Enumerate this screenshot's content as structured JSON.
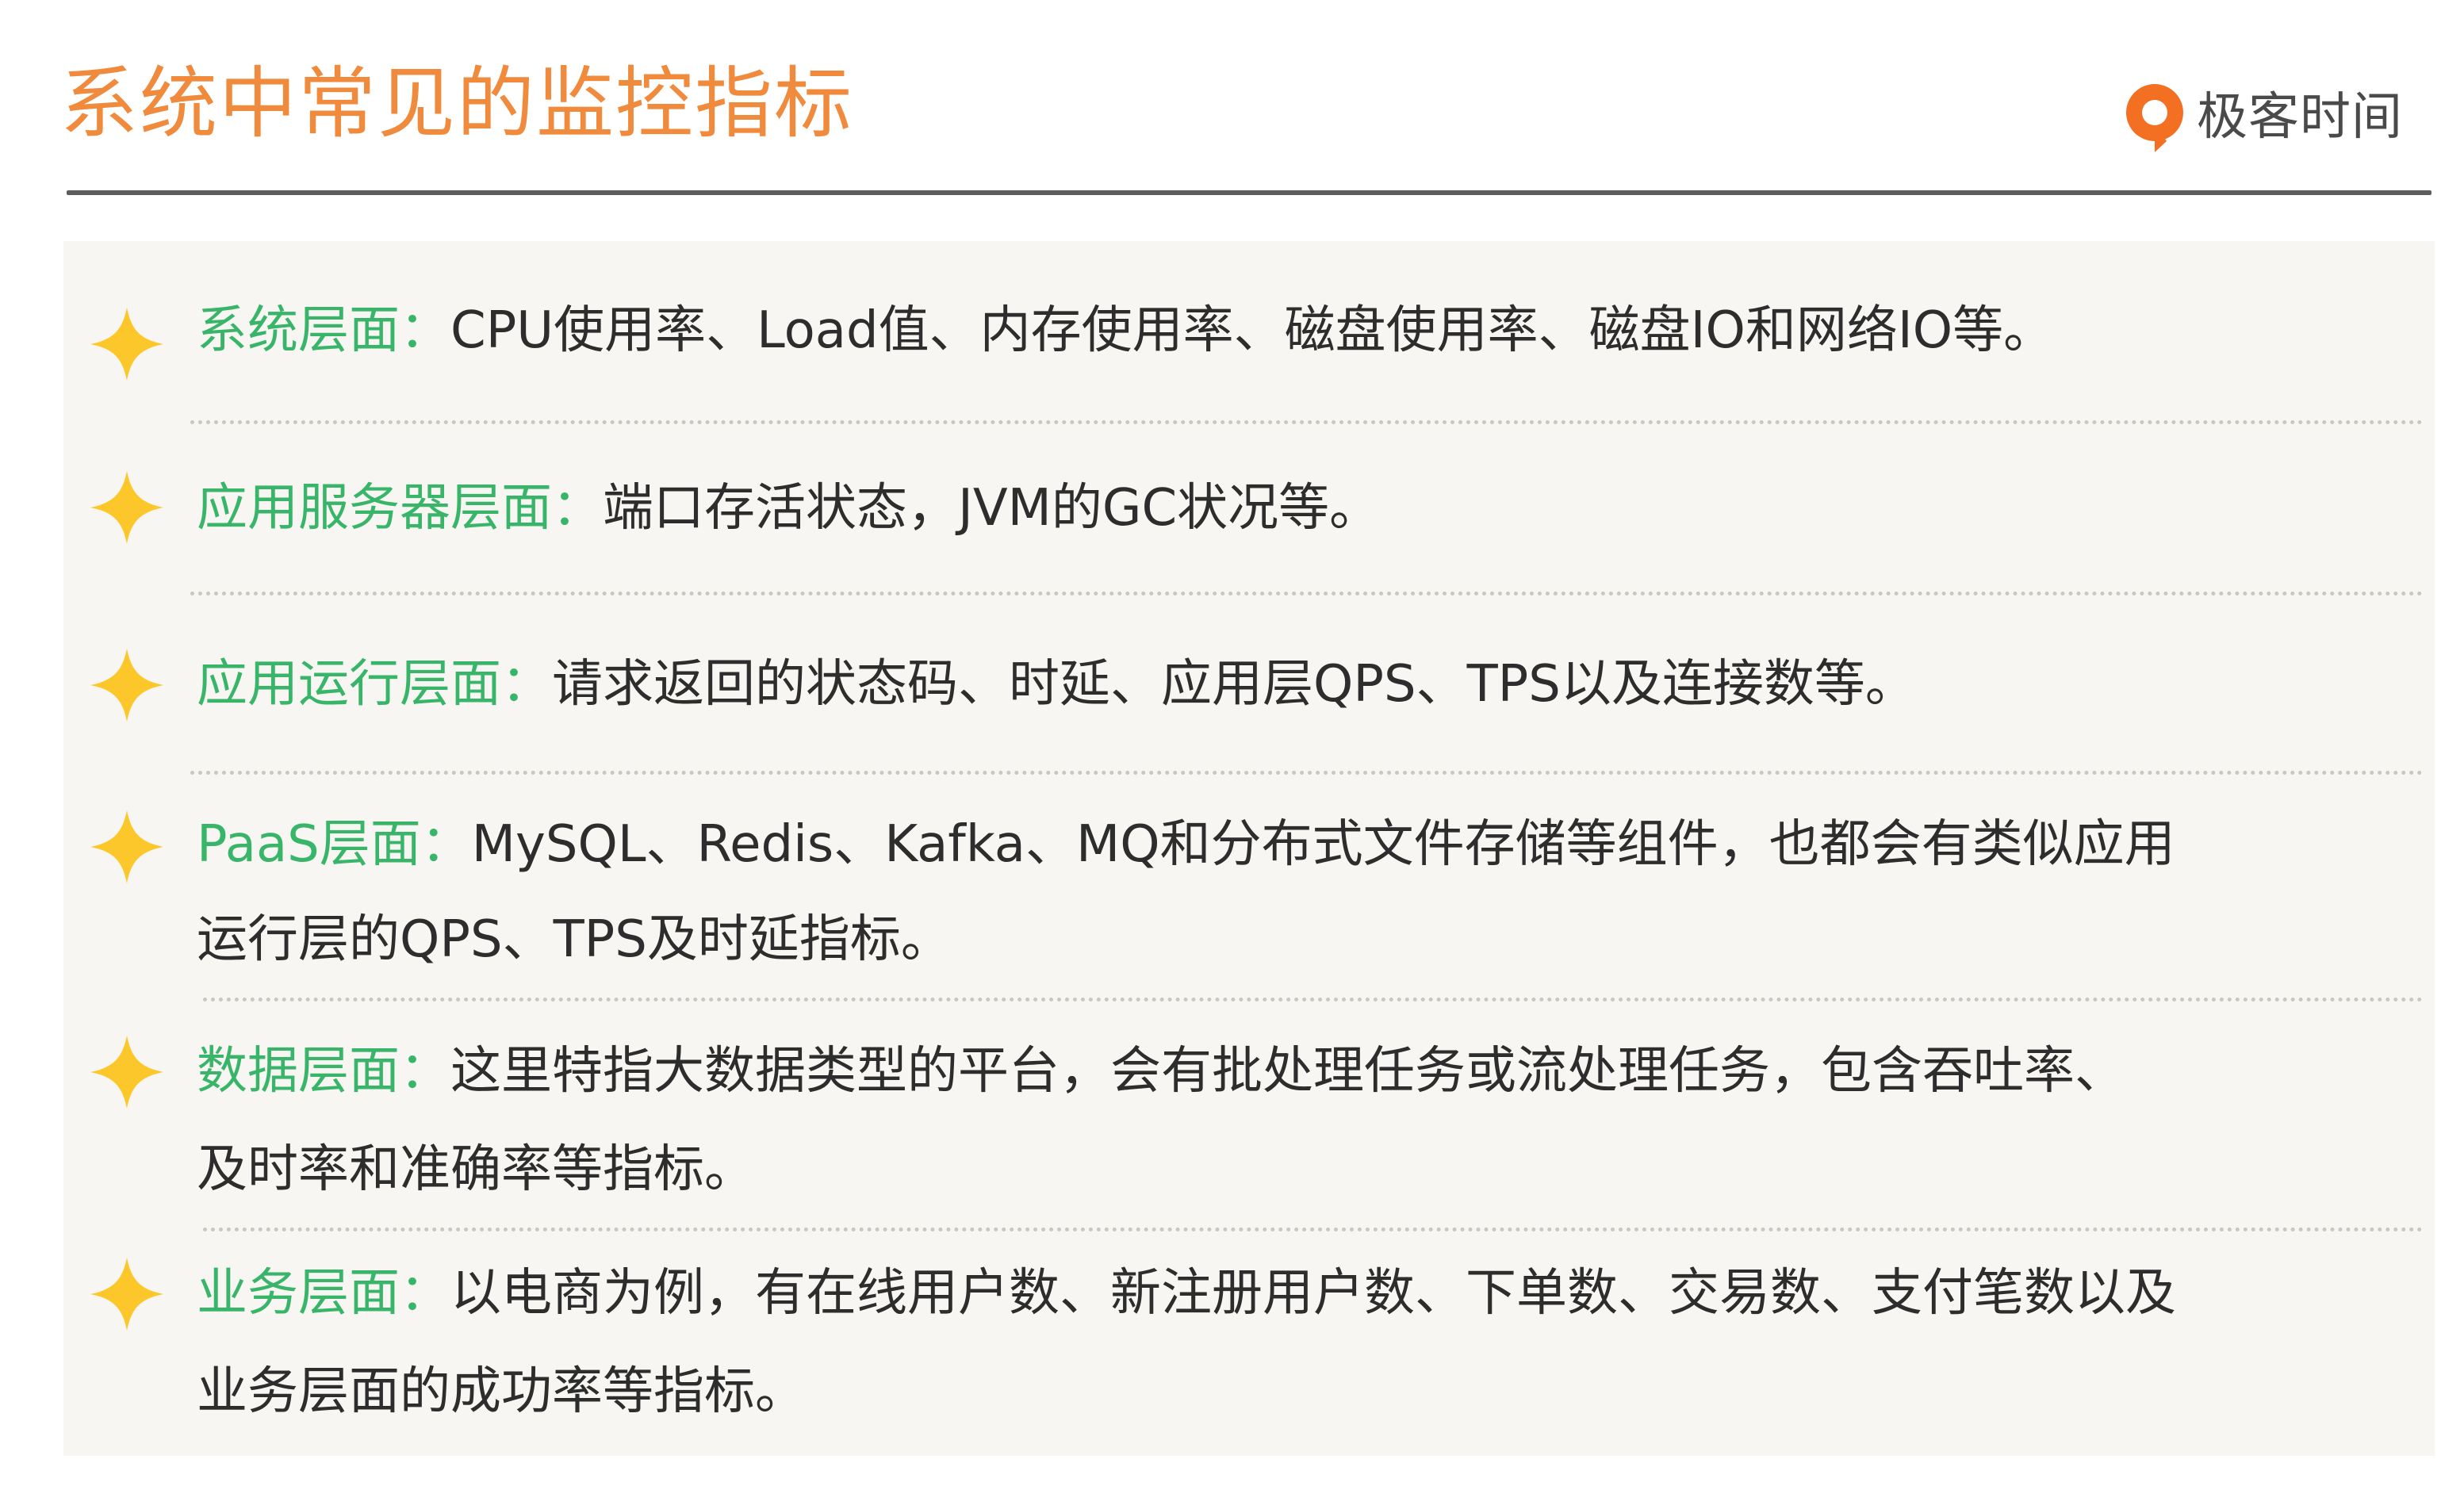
{
  "header": {
    "title": "系统中常见的监控指标",
    "logo_text": "极客时间"
  },
  "items": [
    {
      "label": "系统层面：",
      "line1": "CPU使用率、Load值、内存使用率、磁盘使用率、磁盘IO和网络IO等。",
      "line2": ""
    },
    {
      "label": "应用服务器层面：",
      "line1": "端口存活状态，JVM的GC状况等。",
      "line2": ""
    },
    {
      "label": "应用运行层面：",
      "line1": "请求返回的状态码、时延、应用层QPS、TPS以及连接数等。",
      "line2": ""
    },
    {
      "label": "PaaS层面：",
      "line1": "MySQL、Redis、Kafka、MQ和分布式文件存储等组件，也都会有类似应用",
      "line2": "运行层的QPS、TPS及时延指标。"
    },
    {
      "label": "数据层面：",
      "line1": "这里特指大数据类型的平台，会有批处理任务或流处理任务，包含吞吐率、",
      "line2": "及时率和准确率等指标。"
    },
    {
      "label": "业务层面：",
      "line1": "以电商为例，有在线用户数、新注册用户数、下单数、交易数、支付笔数以及",
      "line2": "业务层面的成功率等指标。"
    }
  ],
  "colors": {
    "title": "#f08a3c",
    "label": "#39b56a",
    "body_text": "#2d2d2d",
    "star": "#fcc72b",
    "panel_background": "#f7f6f2",
    "divider": "#cbc7c0",
    "logo_mark": "#f36f21"
  },
  "icons": {
    "bullet": "four-point-star-icon",
    "logo": "geektime-logo-icon"
  }
}
